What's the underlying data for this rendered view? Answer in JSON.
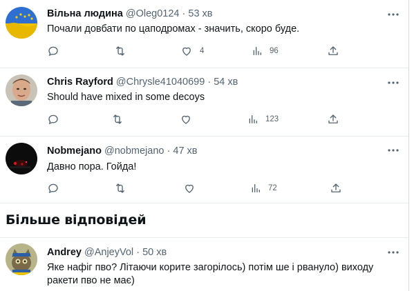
{
  "tweets": [
    {
      "name": "Вільна людина",
      "handle": "@Oleg0124",
      "dot": "·",
      "time": "53 хв",
      "text": "Почали довбати по цаподромах - значить, скоро буде.",
      "likes": "4",
      "views": "96"
    },
    {
      "name": "Chris Rayford",
      "handle": "@Chrysle41040699",
      "dot": "·",
      "time": "54 хв",
      "text": "Should have mixed in some decoys",
      "likes": "",
      "views": "123"
    },
    {
      "name": "Nobmejano",
      "handle": "@nobmejano",
      "dot": "·",
      "time": "47 хв",
      "text": "Давно пора. Гойда!",
      "likes": "",
      "views": "72"
    }
  ],
  "section": {
    "title": "Більше відповідей"
  },
  "more_reply": {
    "name": "Andrey",
    "handle": "@AnjeyVol",
    "dot": "·",
    "time": "50 хв",
    "text_line1": "Яке нафіг пво? Літаючи корите загорілось) потім ше і рвануло) виходу",
    "text_line2": "ракети пво не має)"
  },
  "colors": {
    "text": "#0f1419",
    "secondary": "#536471",
    "divider": "#e7ecef"
  },
  "icons": {
    "reply": "reply-icon",
    "retweet": "retweet-icon",
    "like": "like-icon",
    "views": "views-icon",
    "share": "share-icon",
    "more": "more-icon"
  }
}
